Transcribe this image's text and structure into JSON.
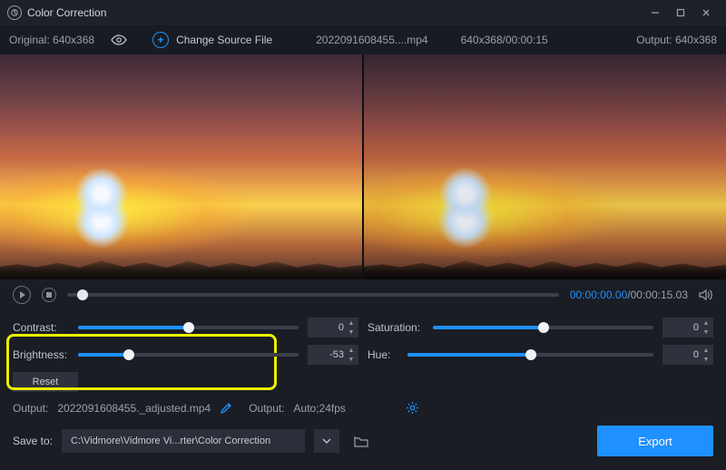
{
  "window": {
    "title": "Color Correction"
  },
  "sourcebar": {
    "original_label": "Original: 640x368",
    "change_label": "Change Source File",
    "file_name": "2022091608455....mp4",
    "dims_time": "640x368/00:00:15",
    "output_label": "Output: 640x368"
  },
  "playback": {
    "current": "00:00:00.00",
    "duration": "00:00:15.03",
    "position_pct": 2
  },
  "sliders": {
    "contrast": {
      "label": "Contrast:",
      "value": 0,
      "fill_pct": 50,
      "knob_pct": 50
    },
    "saturation": {
      "label": "Saturation:",
      "value": 0,
      "fill_pct": 50,
      "knob_pct": 50
    },
    "brightness": {
      "label": "Brightness:",
      "value": -53,
      "fill_pct": 23,
      "knob_pct": 23
    },
    "hue": {
      "label": "Hue:",
      "value": 0,
      "fill_pct": 50,
      "knob_pct": 50
    }
  },
  "reset_label": "Reset",
  "output": {
    "prefix1": "Output:",
    "filename": "2022091608455._adjusted.mp4",
    "prefix2": "Output:",
    "format": "Auto;24fps"
  },
  "save": {
    "label": "Save to:",
    "path": "C:\\Vidmore\\Vidmore Vi...rter\\Color Correction"
  },
  "export_label": "Export"
}
